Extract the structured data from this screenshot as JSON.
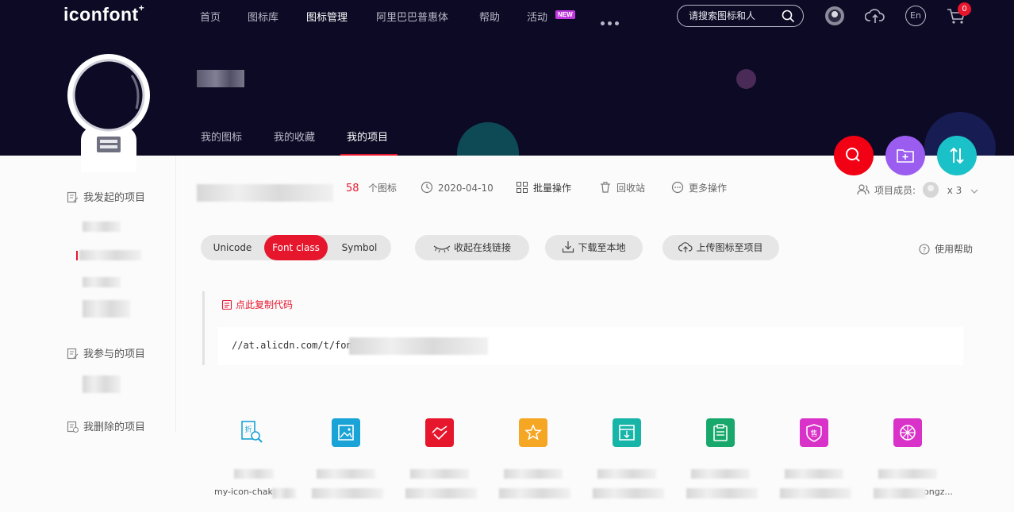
{
  "nav": {
    "logo": "iconfont",
    "logo_plus": "+",
    "items": [
      "首页",
      "图标库",
      "图标管理",
      "阿里巴巴普惠体",
      "帮助",
      "活动"
    ],
    "new_badge": "NEW",
    "active_item": "图标管理",
    "search_placeholder": "请搜索图标和人",
    "lang": "En",
    "cart_count": "0"
  },
  "profile": {
    "tabs": [
      "我的图标",
      "我的收藏",
      "我的项目"
    ],
    "active_tab": "我的项目"
  },
  "sidebar": {
    "started": "我发起的项目",
    "joined": "我参与的项目",
    "deleted": "我删除的项目"
  },
  "project": {
    "icon_count": "58",
    "icon_count_label": "个图标",
    "date": "2020-04-10",
    "batch": "批量操作",
    "recycle": "回收站",
    "more": "更多操作",
    "members_label": "项目成员:",
    "members_count": "x 3"
  },
  "toolbar": {
    "formats": [
      "Unicode",
      "Font class",
      "Symbol"
    ],
    "active_format": "Font class",
    "collapse": "收起在线链接",
    "download": "下载至本地",
    "upload": "上传图标至项目",
    "help": "使用帮助"
  },
  "code": {
    "copy": "点此复制代码",
    "url": "//at.alicdn.com/t/fon"
  },
  "icons": [
    {
      "color": "#1aa3d6",
      "icon": "search-document-icon",
      "label": "my-icon-chaka"
    },
    {
      "color": "#1aa3d6",
      "icon": "image-icon",
      "label": ""
    },
    {
      "color": "#e6162d",
      "icon": "handshake-icon",
      "label": ""
    },
    {
      "color": "#f5a623",
      "icon": "star-icon",
      "label": ""
    },
    {
      "color": "#17b5a8",
      "icon": "download-box-icon",
      "label": ""
    },
    {
      "color": "#18a86b",
      "icon": "clipboard-icon",
      "label": ""
    },
    {
      "color": "#d932c9",
      "icon": "sale-shield-icon",
      "label": ""
    },
    {
      "color": "#d932c9",
      "icon": "compass-icon",
      "label": "ongz..."
    }
  ],
  "colors": {
    "accent": "#e6162d",
    "hero": "#0c0a24",
    "purple": "#9b5cf0",
    "teal": "#1bc1c8"
  }
}
